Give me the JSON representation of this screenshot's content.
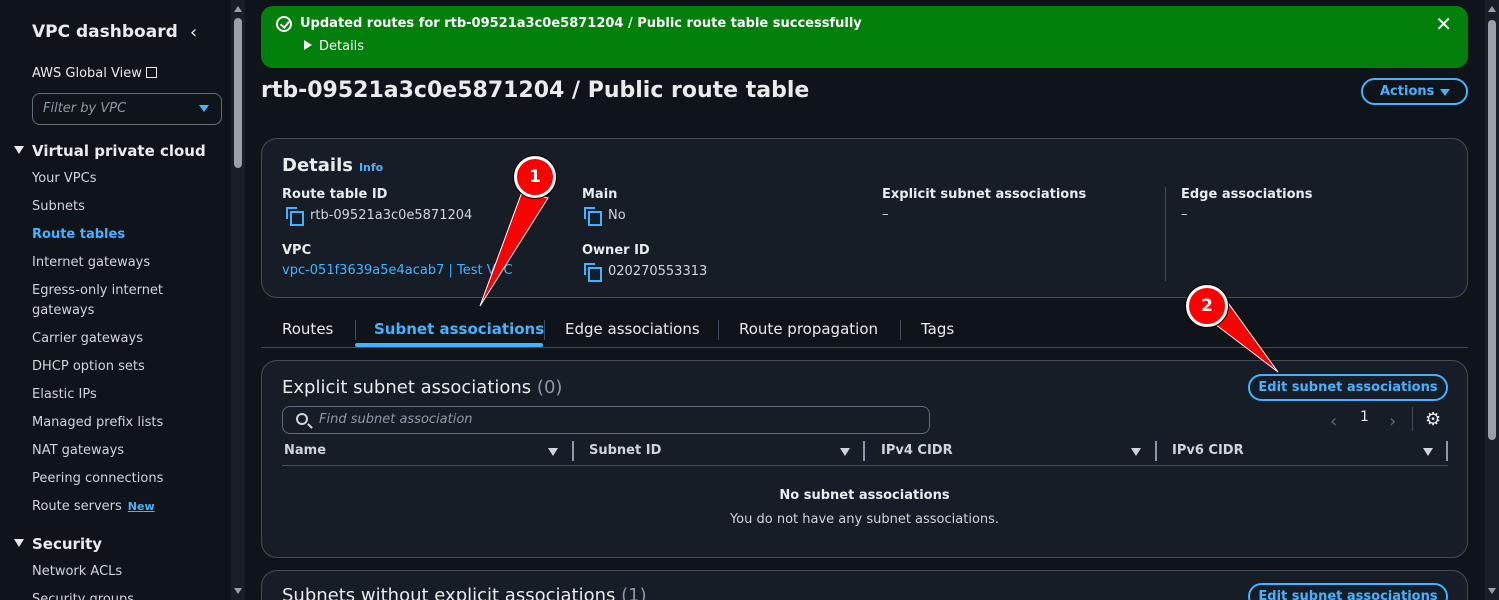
{
  "sidebar": {
    "title": "VPC dashboard",
    "collapse_icon": "chevron-left-icon",
    "global_view": "AWS Global View",
    "filter_placeholder": "Filter by VPC",
    "section_vpc": "Virtual private cloud",
    "items": [
      {
        "label": "Your VPCs"
      },
      {
        "label": "Subnets"
      },
      {
        "label": "Route tables",
        "active": true
      },
      {
        "label": "Internet gateways"
      },
      {
        "label": "Egress-only internet gateways"
      },
      {
        "label": "Carrier gateways"
      },
      {
        "label": "DHCP option sets"
      },
      {
        "label": "Elastic IPs"
      },
      {
        "label": "Managed prefix lists"
      },
      {
        "label": "NAT gateways"
      },
      {
        "label": "Peering connections"
      },
      {
        "label": "Route servers",
        "badge": "New"
      }
    ],
    "section_security": "Security",
    "security_items": [
      {
        "label": "Network ACLs"
      },
      {
        "label": "Security groups"
      }
    ]
  },
  "flash": {
    "message": "Updated routes for rtb-09521a3c0e5871204 / Public route table successfully",
    "details": "Details",
    "color": "#037f0c"
  },
  "page": {
    "title": "rtb-09521a3c0e5871204 / Public route table",
    "actions": "Actions"
  },
  "details": {
    "heading": "Details",
    "info": "Info",
    "route_table_id_label": "Route table ID",
    "route_table_id": "rtb-09521a3c0e5871204",
    "main_label": "Main",
    "main_value": "No",
    "explicit_label": "Explicit subnet associations",
    "explicit_value": "–",
    "edge_label": "Edge associations",
    "edge_value": "–",
    "vpc_label": "VPC",
    "vpc_value": "vpc-051f3639a5e4acab7 | Test VPC",
    "owner_label": "Owner ID",
    "owner_value": "020270553313"
  },
  "tabs": [
    {
      "label": "Routes"
    },
    {
      "label": "Subnet associations",
      "active": true
    },
    {
      "label": "Edge associations"
    },
    {
      "label": "Route propagation"
    },
    {
      "label": "Tags"
    }
  ],
  "assoc": {
    "title": "Explicit subnet associations",
    "count": "(0)",
    "edit_button": "Edit subnet associations",
    "search_placeholder": "Find subnet association",
    "page": "1",
    "columns": [
      "Name",
      "Subnet ID",
      "IPv4 CIDR",
      "IPv6 CIDR"
    ],
    "empty_title": "No subnet associations",
    "empty_text": "You do not have any subnet associations."
  },
  "without": {
    "title": "Subnets without explicit associations",
    "count": "(1)",
    "edit_button": "Edit subnet associations"
  },
  "annotations": [
    {
      "label": "1"
    },
    {
      "label": "2"
    }
  ],
  "accent_color": "#42b4ff"
}
